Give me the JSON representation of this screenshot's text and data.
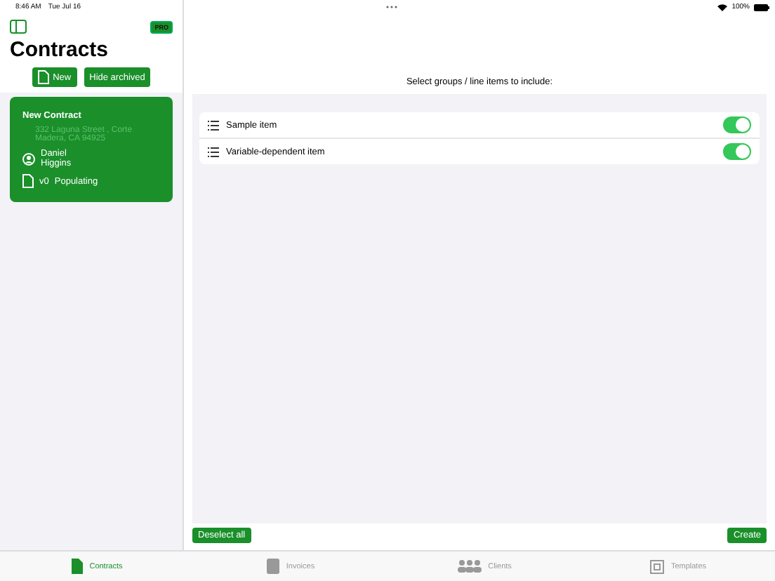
{
  "status_bar": {
    "time": "8:46 AM",
    "date": "Tue Jul 16",
    "battery": "100%"
  },
  "sidebar": {
    "badge": "PRO",
    "title": "Contracts",
    "buttons": [
      "New",
      "Hide archived"
    ],
    "contracts": [
      {
        "title": "New Contract",
        "address": "332 Laguna Street , Corte Madera, CA 94925",
        "client": "Daniel Higgins",
        "version": "v0",
        "status": "Populating",
        "selected": true
      }
    ]
  },
  "detail": {
    "prompt": "Select groups / line items to include:",
    "items": [
      {
        "label": "Sample item",
        "on": true
      },
      {
        "label": "Variable-dependent item",
        "on": true
      }
    ],
    "deselect_button": "Deselect all",
    "create_button": "Create"
  },
  "tabs": [
    {
      "label": "Contracts",
      "selected": true
    },
    {
      "label": "Invoices",
      "selected": false
    },
    {
      "label": "Clients",
      "selected": false
    },
    {
      "label": "Templates",
      "selected": false
    }
  ]
}
